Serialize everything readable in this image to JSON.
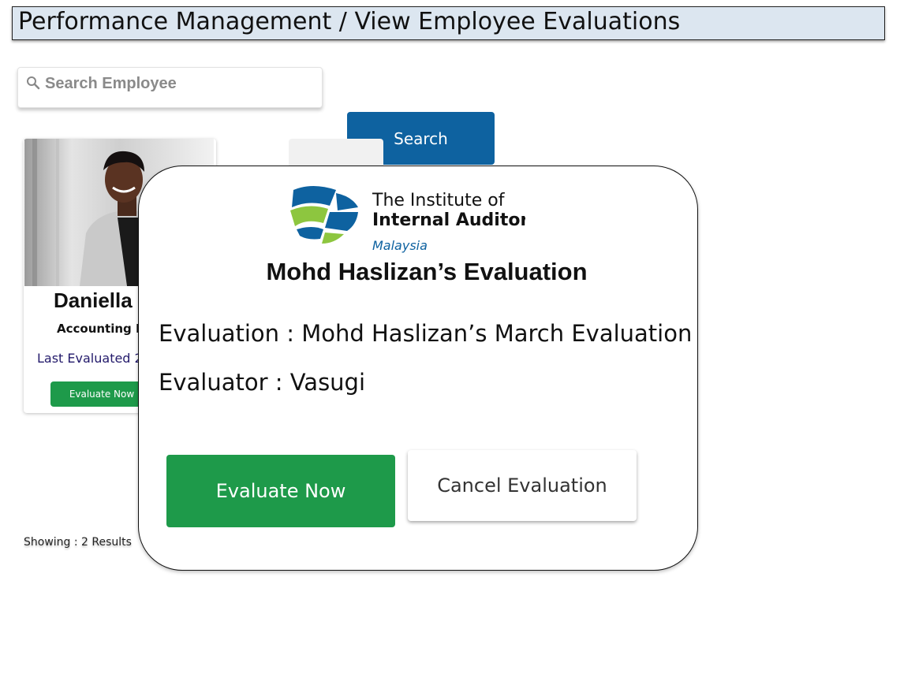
{
  "header": {
    "title": "Performance Management / View Employee Evaluations"
  },
  "search": {
    "placeholder": "Search Employee",
    "button_label": "Search",
    "icon": "search-icon"
  },
  "employee_card": {
    "name": "Daniella",
    "role": "Accounting M",
    "last_evaluated": "Last Evaluated 2",
    "button_label": "Evaluate Now"
  },
  "results": {
    "label": "Showing  : 2 Results"
  },
  "modal": {
    "logo": {
      "line1": "The Institute of",
      "line2": "Internal Auditors",
      "line3": "Malaysia"
    },
    "title": "Mohd Haslizan’s Evaluation",
    "evaluation_line": "Evaluation : Mohd Haslizan’s  March Evaluation",
    "evaluator_line": "Evaluator : Vasugi",
    "evaluate_button": "Evaluate Now",
    "cancel_button": "Cancel Evaluation"
  },
  "colors": {
    "title_bar_bg": "#dce6f0",
    "primary_blue": "#0e62a0",
    "success_green": "#1e9a4a",
    "logo_blue": "#0e62a0",
    "logo_green": "#8dc63f"
  }
}
